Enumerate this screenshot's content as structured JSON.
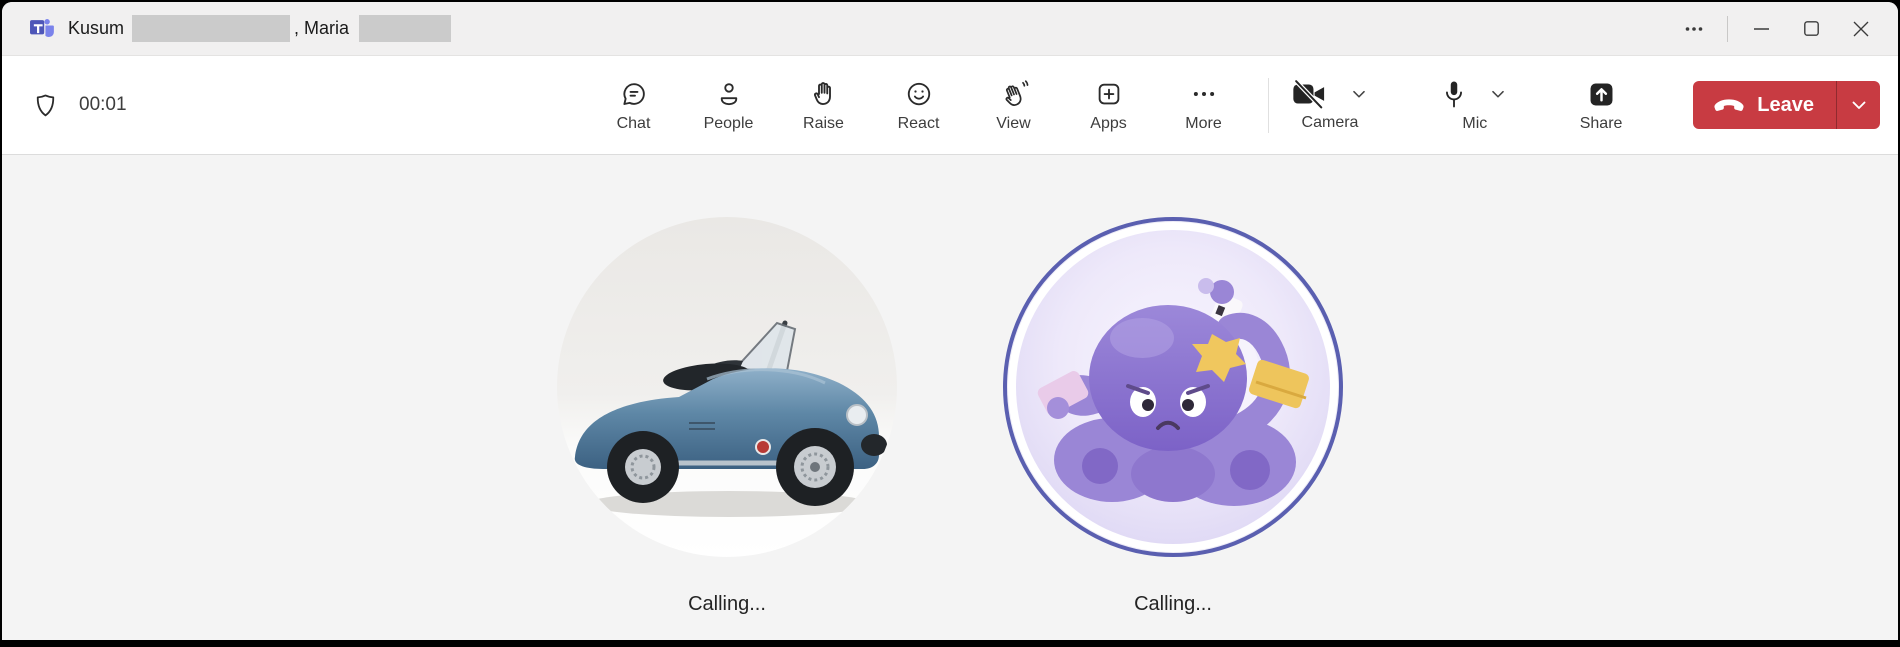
{
  "titlebar": {
    "title_part1": "Kusum",
    "title_part2": ", Maria"
  },
  "toolbar": {
    "timer": "00:01",
    "items": [
      {
        "label": "Chat",
        "icon": "chat-bubble-icon"
      },
      {
        "label": "People",
        "icon": "person-icon"
      },
      {
        "label": "Raise",
        "icon": "raised-hand-icon"
      },
      {
        "label": "React",
        "icon": "smiley-icon"
      },
      {
        "label": "View",
        "icon": "waving-hand-icon"
      },
      {
        "label": "Apps",
        "icon": "plus-square-icon"
      },
      {
        "label": "More",
        "icon": "ellipsis-icon"
      }
    ],
    "camera": {
      "label": "Camera",
      "state": "off"
    },
    "mic": {
      "label": "Mic",
      "state": "on"
    },
    "share": {
      "label": "Share"
    },
    "leave": {
      "label": "Leave"
    }
  },
  "stage": {
    "participants": [
      {
        "status": "Calling...",
        "avatar": "classic-blue-car-photo"
      },
      {
        "status": "Calling...",
        "avatar": "purple-octopus-illustration"
      }
    ]
  },
  "colors": {
    "leave_red": "#C83B42",
    "titlebar_bg": "#F1F0F0",
    "toolbar_bg": "#FFFFFF",
    "stage_bg": "#F4F4F4",
    "icon_color": "#2B2B2B",
    "redaction_gray": "#CBCBCB",
    "teams_purple": "#4E56B8",
    "octopus_ring": "#5A5FB0"
  }
}
